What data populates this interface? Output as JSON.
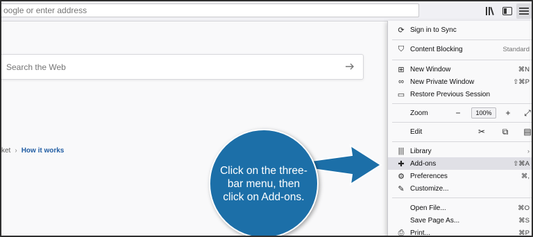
{
  "toolbar": {
    "url_placeholder": "oogle or enter address",
    "icons": [
      "library-icon",
      "sidebar-icon",
      "hamburger-menu-icon"
    ]
  },
  "content": {
    "search_placeholder": "Search the Web",
    "pocket_prefix": "ket",
    "pocket_link": "How it works"
  },
  "callout": {
    "text": "Click on the three-bar menu, then click on Add-ons.",
    "bubble_color": "#1c6fa8"
  },
  "menu": {
    "sign_in": "Sign in to Sync",
    "content_blocking": "Content Blocking",
    "content_blocking_value": "Standard",
    "new_window": "New Window",
    "new_window_sc": "⌘N",
    "new_private": "New Private Window",
    "new_private_sc": "⇧⌘P",
    "restore": "Restore Previous Session",
    "zoom": "Zoom",
    "zoom_minus": "−",
    "zoom_value": "100%",
    "zoom_plus": "+",
    "edit": "Edit",
    "library": "Library",
    "addons": "Add-ons",
    "addons_sc": "⇧⌘A",
    "preferences": "Preferences",
    "preferences_sc": "⌘,",
    "customize": "Customize...",
    "open_file": "Open File...",
    "open_file_sc": "⌘O",
    "save_page": "Save Page As...",
    "save_page_sc": "⌘S",
    "print": "Print...",
    "print_sc": "⌘P"
  }
}
